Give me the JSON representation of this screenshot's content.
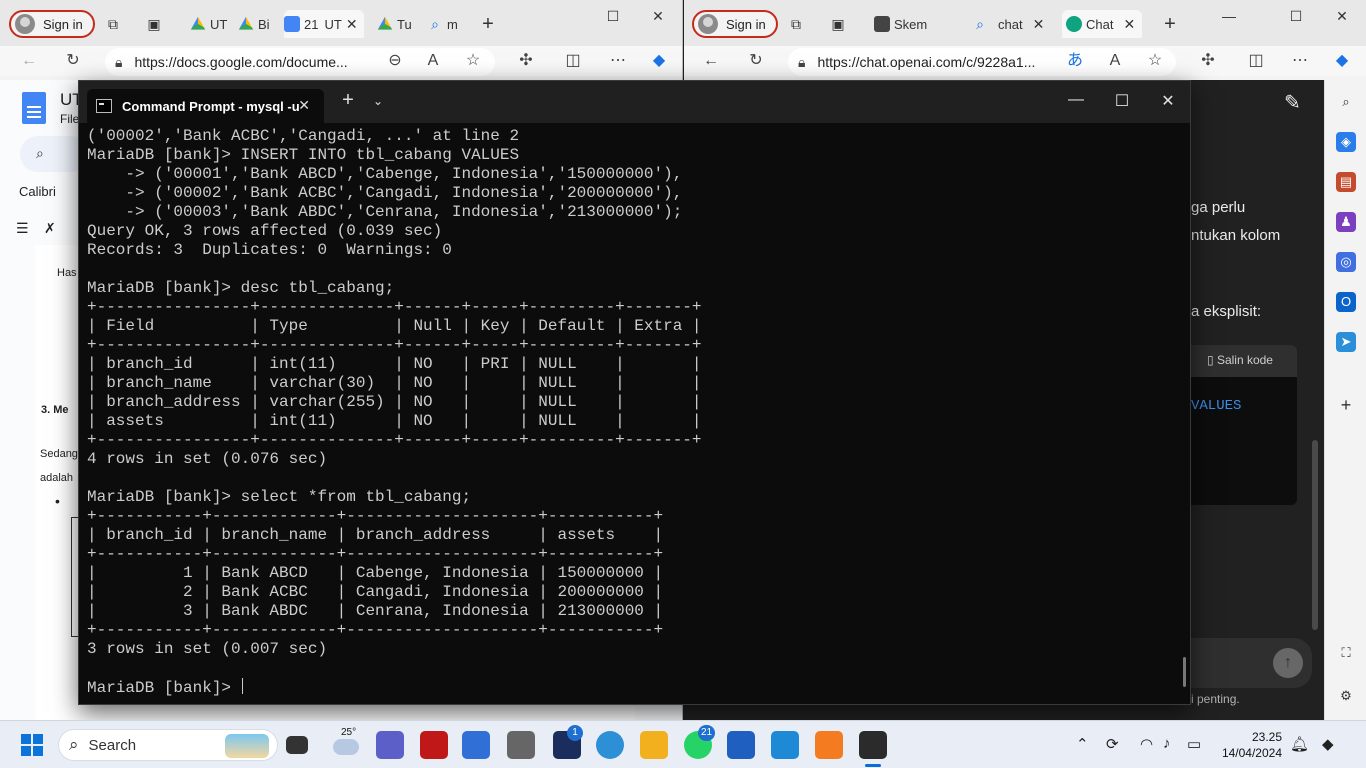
{
  "left_browser": {
    "signin_label": "Sign in",
    "tabs": [
      "UT",
      "Bi",
      "21",
      "UT",
      "Tu",
      "m"
    ],
    "url": "https://docs.google.com/docume...",
    "doc": {
      "title": "UT",
      "menu": "File",
      "font": "Calibri",
      "text_has": "Has",
      "text_section": "3.  Me",
      "text_sedang": "Sedang",
      "text_adalah": "adalah"
    }
  },
  "right_browser": {
    "signin_label": "Sign in",
    "tabs": [
      "Skem",
      "chat",
      "Chat"
    ],
    "url": "https://chat.openai.com/c/9228a1...",
    "chat_lines": [
      "ga perlu",
      "ntukan kolom",
      "a eksplisit:"
    ],
    "copy_code_label": "Salin kode",
    "code_keyword": "VALUES",
    "footer_text": "i penting."
  },
  "cmd": {
    "tab_title": "Command Prompt - mysql  -u",
    "lines": [
      "('00002','Bank ACBC','Cangadi, ...' at line 2",
      "MariaDB [bank]> INSERT INTO tbl_cabang VALUES",
      "    -> ('00001','Bank ABCD','Cabenge, Indonesia','150000000'),",
      "    -> ('00002','Bank ACBC','Cangadi, Indonesia','200000000'),",
      "    -> ('00003','Bank ABDC','Cenrana, Indonesia','213000000');",
      "Query OK, 3 rows affected (0.039 sec)",
      "Records: 3  Duplicates: 0  Warnings: 0",
      "",
      "MariaDB [bank]> desc tbl_cabang;",
      "+----------------+--------------+------+-----+---------+-------+",
      "| Field          | Type         | Null | Key | Default | Extra |",
      "+----------------+--------------+------+-----+---------+-------+",
      "| branch_id      | int(11)      | NO   | PRI | NULL    |       |",
      "| branch_name    | varchar(30)  | NO   |     | NULL    |       |",
      "| branch_address | varchar(255) | NO   |     | NULL    |       |",
      "| assets         | int(11)      | NO   |     | NULL    |       |",
      "+----------------+--------------+------+-----+---------+-------+",
      "4 rows in set (0.076 sec)",
      "",
      "MariaDB [bank]> select *from tbl_cabang;",
      "+-----------+-------------+--------------------+-----------+",
      "| branch_id | branch_name | branch_address     | assets    |",
      "+-----------+-------------+--------------------+-----------+",
      "|         1 | Bank ABCD   | Cabenge, Indonesia | 150000000 |",
      "|         2 | Bank ACBC   | Cangadi, Indonesia | 200000000 |",
      "|         3 | Bank ABDC   | Cenrana, Indonesia | 213000000 |",
      "+-----------+-------------+--------------------+-----------+",
      "3 rows in set (0.007 sec)",
      "",
      "MariaDB [bank]> "
    ]
  },
  "taskbar": {
    "search_label": "Search",
    "weather": "25°",
    "badge_l": "1",
    "badge_whatsapp": "21",
    "time": "23.25",
    "date": "14/04/2024"
  }
}
